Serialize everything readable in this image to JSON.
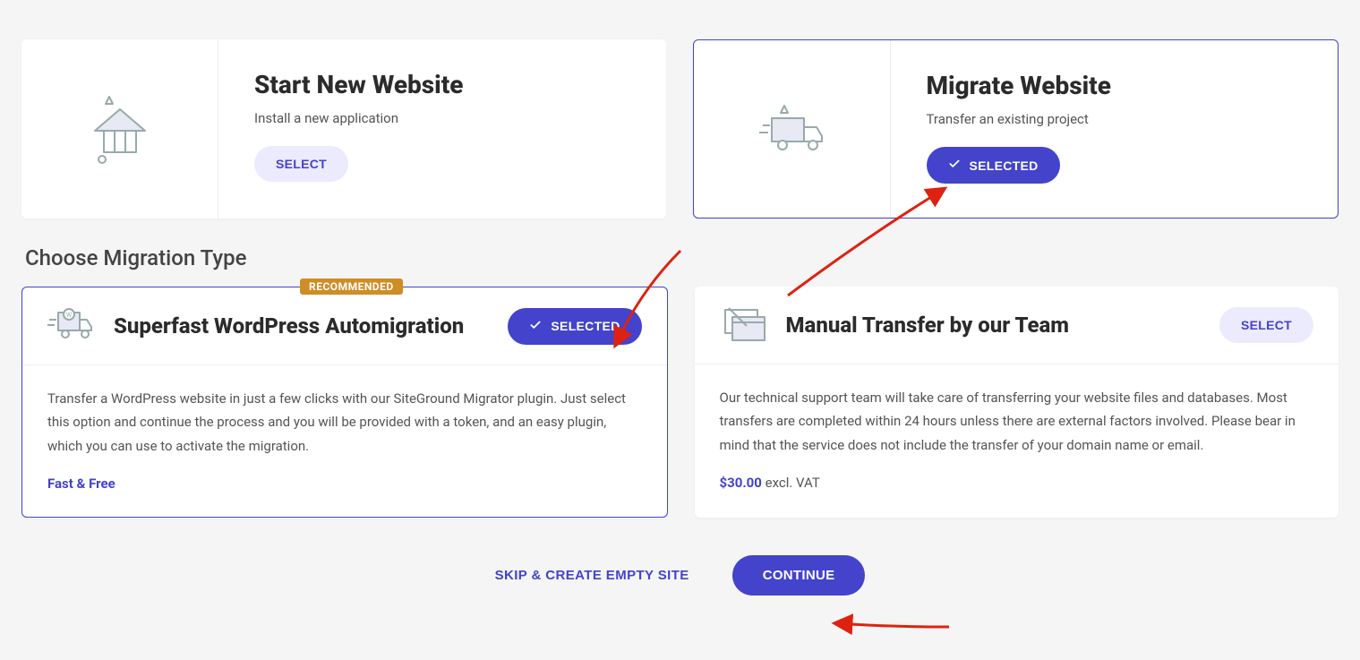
{
  "top": {
    "left": {
      "title": "Start New Website",
      "subtitle": "Install a new application",
      "button": "SELECT"
    },
    "right": {
      "title": "Migrate Website",
      "subtitle": "Transfer an existing project",
      "button": "SELECTED"
    }
  },
  "section_title": "Choose Migration Type",
  "migration": {
    "left": {
      "badge": "RECOMMENDED",
      "title": "Superfast WordPress Automigration",
      "button": "SELECTED",
      "desc": "Transfer a WordPress website in just a few clicks with our SiteGround Migrator plugin. Just select this option and continue the process and you will be provided with a token, and an easy plugin, which you can use to activate the migration.",
      "foot": "Fast & Free"
    },
    "right": {
      "title": "Manual Transfer by our Team",
      "button": "SELECT",
      "desc": "Our technical support team will take care of transferring your website files and databases. Most transfers are completed within 24 hours unless there are external factors involved. Please bear in mind that the service does not include the transfer of your domain name or email.",
      "price": "$30.00",
      "vat": " excl. VAT"
    }
  },
  "actions": {
    "skip": "SKIP & CREATE EMPTY SITE",
    "continue": "CONTINUE"
  }
}
